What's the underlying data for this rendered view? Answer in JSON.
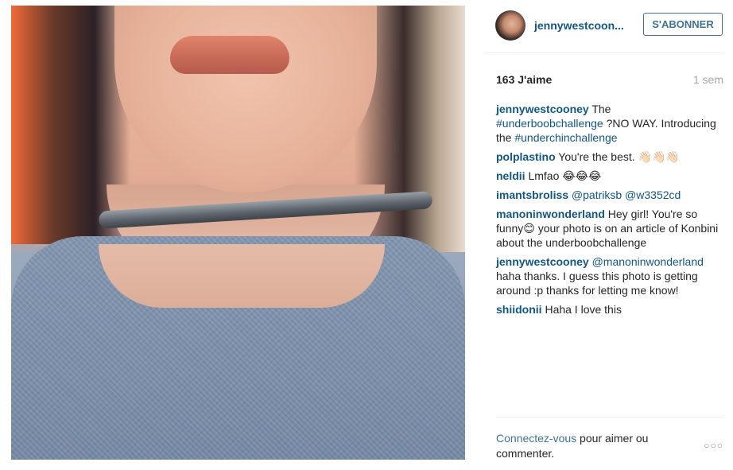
{
  "post": {
    "photo_alt": "selfie photo"
  },
  "header": {
    "username": "jennywestcoon...",
    "follow_label": "S'ABONNER"
  },
  "stats": {
    "likes": "163 J'aime",
    "time": "1 sem"
  },
  "comments": [
    {
      "user": "jennywestcooney",
      "parts": [
        {
          "text": " The ",
          "link": false
        },
        {
          "text": "#underboobchallenge",
          "link": true
        },
        {
          "text": " ?NO WAY. Introducing the ",
          "link": false
        },
        {
          "text": "#underchinchallenge",
          "link": true
        }
      ]
    },
    {
      "user": "polplastino",
      "parts": [
        {
          "text": " You're the best. 👋🏻👋🏻👋🏻",
          "link": false
        }
      ]
    },
    {
      "user": "neldii",
      "parts": [
        {
          "text": " Lmfao 😂😂😂",
          "link": false
        }
      ]
    },
    {
      "user": "imantsbroliss",
      "parts": [
        {
          "text": " ",
          "link": false
        },
        {
          "text": "@patriksb",
          "link": true
        },
        {
          "text": " ",
          "link": false
        },
        {
          "text": "@w3352cd",
          "link": true
        }
      ]
    },
    {
      "user": "manoninwonderland",
      "parts": [
        {
          "text": " Hey girl! You're so funny😊 your photo is on an article of Konbini about the underboobchallenge",
          "link": false
        }
      ]
    },
    {
      "user": "jennywestcooney",
      "parts": [
        {
          "text": " ",
          "link": false
        },
        {
          "text": "@manoninwonderland",
          "link": true
        },
        {
          "text": " haha thanks. I guess this photo is getting around :p thanks for letting me know!",
          "link": false
        }
      ]
    },
    {
      "user": "shiidonii",
      "parts": [
        {
          "text": " Haha I love this",
          "link": false
        }
      ]
    }
  ],
  "footer": {
    "login_link": "Connectez-vous",
    "login_rest": " pour aimer ou commenter.",
    "more_icon": "ellipsis-icon",
    "more_glyph": "○○○"
  }
}
